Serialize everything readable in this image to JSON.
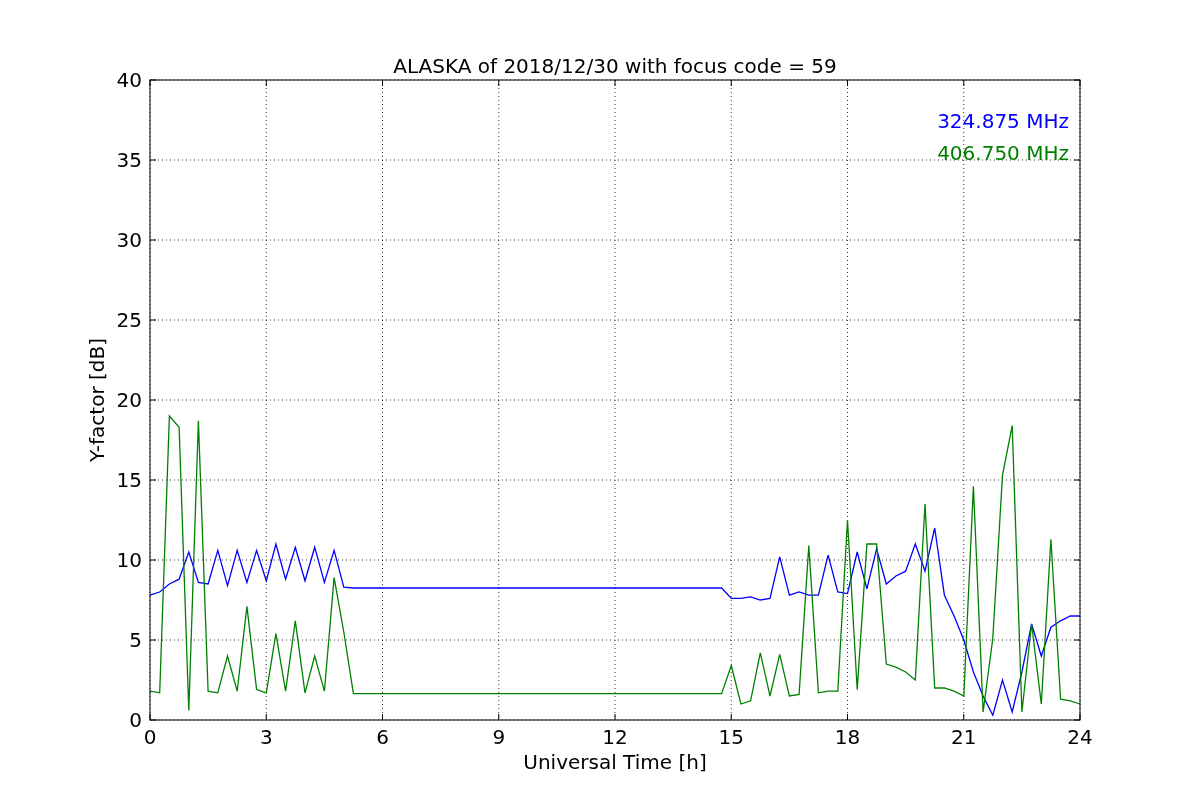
{
  "chart_data": {
    "type": "line",
    "title": "ALASKA of 2018/12/30 with focus code = 59",
    "xlabel": "Universal Time [h]",
    "ylabel": "Y-factor [dB]",
    "x": [
      0,
      0.25,
      0.5,
      0.75,
      1,
      1.25,
      1.5,
      1.75,
      2,
      2.25,
      2.5,
      2.75,
      3,
      3.25,
      3.5,
      3.75,
      4,
      4.25,
      4.5,
      4.75,
      5,
      5.25,
      5.5,
      5.75,
      6,
      6.25,
      6.5,
      6.75,
      7,
      7.25,
      7.5,
      7.75,
      8,
      8.25,
      8.5,
      8.75,
      9,
      9.25,
      9.5,
      9.75,
      10,
      10.25,
      10.5,
      10.75,
      11,
      11.25,
      11.5,
      11.75,
      12,
      12.25,
      12.5,
      12.75,
      13,
      13.25,
      13.5,
      13.75,
      14,
      14.25,
      14.5,
      14.75,
      15,
      15.25,
      15.5,
      15.75,
      16,
      16.25,
      16.5,
      16.75,
      17,
      17.25,
      17.5,
      17.75,
      18,
      18.25,
      18.5,
      18.75,
      19,
      19.25,
      19.5,
      19.75,
      20,
      20.25,
      20.5,
      20.75,
      21,
      21.25,
      21.5,
      21.75,
      22,
      22.25,
      22.5,
      22.75,
      23,
      23.25,
      23.5,
      23.75,
      24
    ],
    "series": [
      {
        "name": "324.875 MHz",
        "color": "#0000ff",
        "values": [
          7.8,
          8.0,
          8.5,
          8.8,
          10.5,
          8.6,
          8.5,
          10.6,
          8.4,
          10.6,
          8.6,
          10.6,
          8.7,
          11.0,
          8.8,
          10.8,
          8.7,
          10.8,
          8.6,
          10.6,
          8.3,
          8.25,
          8.25,
          8.25,
          8.25,
          8.25,
          8.25,
          8.25,
          8.25,
          8.25,
          8.25,
          8.25,
          8.25,
          8.25,
          8.25,
          8.25,
          8.25,
          8.25,
          8.25,
          8.25,
          8.25,
          8.25,
          8.25,
          8.25,
          8.25,
          8.25,
          8.25,
          8.25,
          8.25,
          8.25,
          8.25,
          8.25,
          8.25,
          8.25,
          8.25,
          8.25,
          8.25,
          8.25,
          8.25,
          8.25,
          7.6,
          7.6,
          7.7,
          7.5,
          7.6,
          10.2,
          7.8,
          8.0,
          7.8,
          7.8,
          10.3,
          8.0,
          7.9,
          10.5,
          8.2,
          10.7,
          8.5,
          9.0,
          9.3,
          11.0,
          9.3,
          12.0,
          7.8,
          6.5,
          5.0,
          3.0,
          1.5,
          0.3,
          2.5,
          0.5,
          3.0,
          6.0,
          4.0,
          5.8,
          6.2,
          6.5,
          6.5
        ]
      },
      {
        "name": "406.750 MHz",
        "color": "#008000",
        "values": [
          1.8,
          1.7,
          19.0,
          18.3,
          0.6,
          18.7,
          1.8,
          1.7,
          4.0,
          1.8,
          7.1,
          1.9,
          1.7,
          5.4,
          1.8,
          6.2,
          1.7,
          4.0,
          1.8,
          8.9,
          5.5,
          1.65,
          1.65,
          1.65,
          1.65,
          1.65,
          1.65,
          1.65,
          1.65,
          1.65,
          1.65,
          1.65,
          1.65,
          1.65,
          1.65,
          1.65,
          1.65,
          1.65,
          1.65,
          1.65,
          1.65,
          1.65,
          1.65,
          1.65,
          1.65,
          1.65,
          1.65,
          1.65,
          1.65,
          1.65,
          1.65,
          1.65,
          1.65,
          1.65,
          1.65,
          1.65,
          1.65,
          1.65,
          1.65,
          1.65,
          3.4,
          1.0,
          1.2,
          4.2,
          1.5,
          4.1,
          1.5,
          1.6,
          10.9,
          1.7,
          1.8,
          1.8,
          12.5,
          1.9,
          11.0,
          11.0,
          3.5,
          3.3,
          3.0,
          2.5,
          13.5,
          2.0,
          2.0,
          1.8,
          1.5,
          14.6,
          0.5,
          5.1,
          15.3,
          18.4,
          0.5,
          6.0,
          1.0,
          11.3,
          1.3,
          1.2,
          1.0
        ]
      }
    ],
    "xlim": [
      0,
      24
    ],
    "ylim": [
      0,
      40
    ],
    "xticks": [
      0,
      3,
      6,
      9,
      12,
      15,
      18,
      21,
      24
    ],
    "yticks": [
      0,
      5,
      10,
      15,
      20,
      25,
      30,
      35,
      40
    ],
    "grid": true
  }
}
